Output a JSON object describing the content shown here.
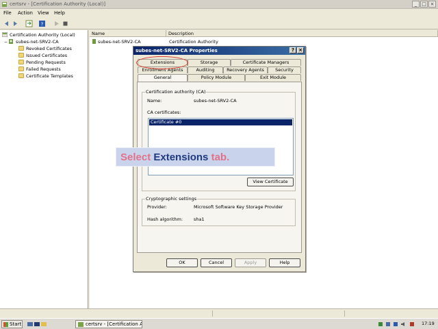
{
  "window": {
    "title": "certsrv - [Certification Authority (Local)]"
  },
  "menu": [
    "File",
    "Action",
    "View",
    "Help"
  ],
  "tree": {
    "root": "Certification Authority (Local)",
    "ca": "subes-net-SRV2-CA",
    "folders": [
      "Revoked Certificates",
      "Issued Certificates",
      "Pending Requests",
      "Failed Requests",
      "Certificate Templates"
    ]
  },
  "list": {
    "columns": [
      "Name",
      "Description"
    ],
    "rows": [
      {
        "name": "subes-net-SRV2-CA",
        "description": "Certification Authority"
      }
    ]
  },
  "dialog": {
    "title": "subes-net-SRV2-CA Properties",
    "help_glyph": "?",
    "close_glyph": "×",
    "tabs_row1": [
      "Extensions",
      "Storage",
      "Certificate Managers"
    ],
    "tabs_row2": [
      "Enrollment Agents",
      "Auditing",
      "Recovery Agents",
      "Security"
    ],
    "tabs_row3": [
      "General",
      "Policy Module",
      "Exit Module"
    ],
    "ca_group": "Certification authority (CA)",
    "name_label": "Name:",
    "name_value": "subes-net-SRV2-CA",
    "certs_label": "CA certificates:",
    "selected_cert": "Certificate #0",
    "view_cert_button": "View Certificate",
    "crypto_group": "Cryptographic settings",
    "provider_label": "Provider:",
    "provider_value": "Microsoft Software Key Storage Provider",
    "hash_label": "Hash algorithm:",
    "hash_value": "sha1",
    "buttons": {
      "ok": "OK",
      "cancel": "Cancel",
      "apply": "Apply",
      "help": "Help"
    }
  },
  "callout": {
    "part1": "Select ",
    "part2": "Extensions",
    "part3": " tab."
  },
  "taskbar": {
    "start": "Start",
    "task": "certsrv - [Certification Authority (Local)]",
    "clock": "17:19"
  },
  "colors": {
    "accent": "#0a246a",
    "highlight_ring": "#d83a2a",
    "callout_bg": "#c9d4ec"
  }
}
